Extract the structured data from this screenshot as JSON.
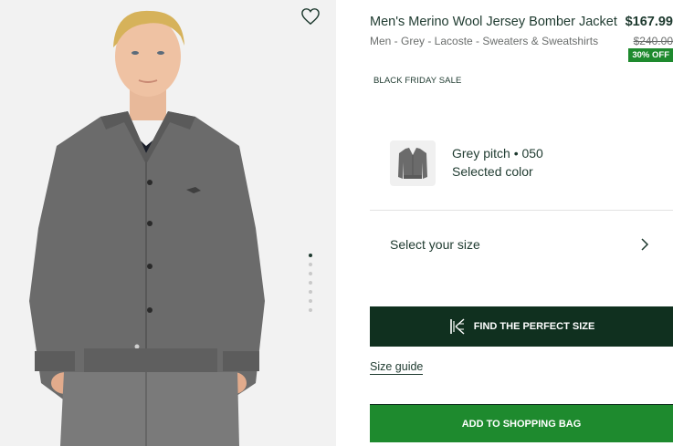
{
  "product": {
    "title": "Men's Merino Wool Jersey Bomber Jacket",
    "meta": "Men - Grey - Lacoste - Sweaters & Sweatshirts",
    "price": "$167.99",
    "original_price": "$240.00",
    "discount_badge": "30% OFF",
    "sale_label": "BLACK FRIDAY SALE"
  },
  "color": {
    "name": "Grey pitch • 050",
    "label": "Selected color"
  },
  "size": {
    "select_label": "Select your size"
  },
  "actions": {
    "perfect_size": "FIND THE PERFECT SIZE",
    "size_guide": "Size guide",
    "add_to_bag": "ADD TO SHOPPING BAG"
  },
  "gallery": {
    "total_images": 7,
    "active_index": 0
  },
  "colors": {
    "brand_dark": "#10301f",
    "brand_green": "#1e8a2e",
    "text_primary": "#1e3a2f",
    "text_muted": "#6c6f6e"
  },
  "icons": {
    "wishlist": "heart-icon",
    "chevron": "chevron-right-icon",
    "fit": "fit-finder-icon"
  }
}
